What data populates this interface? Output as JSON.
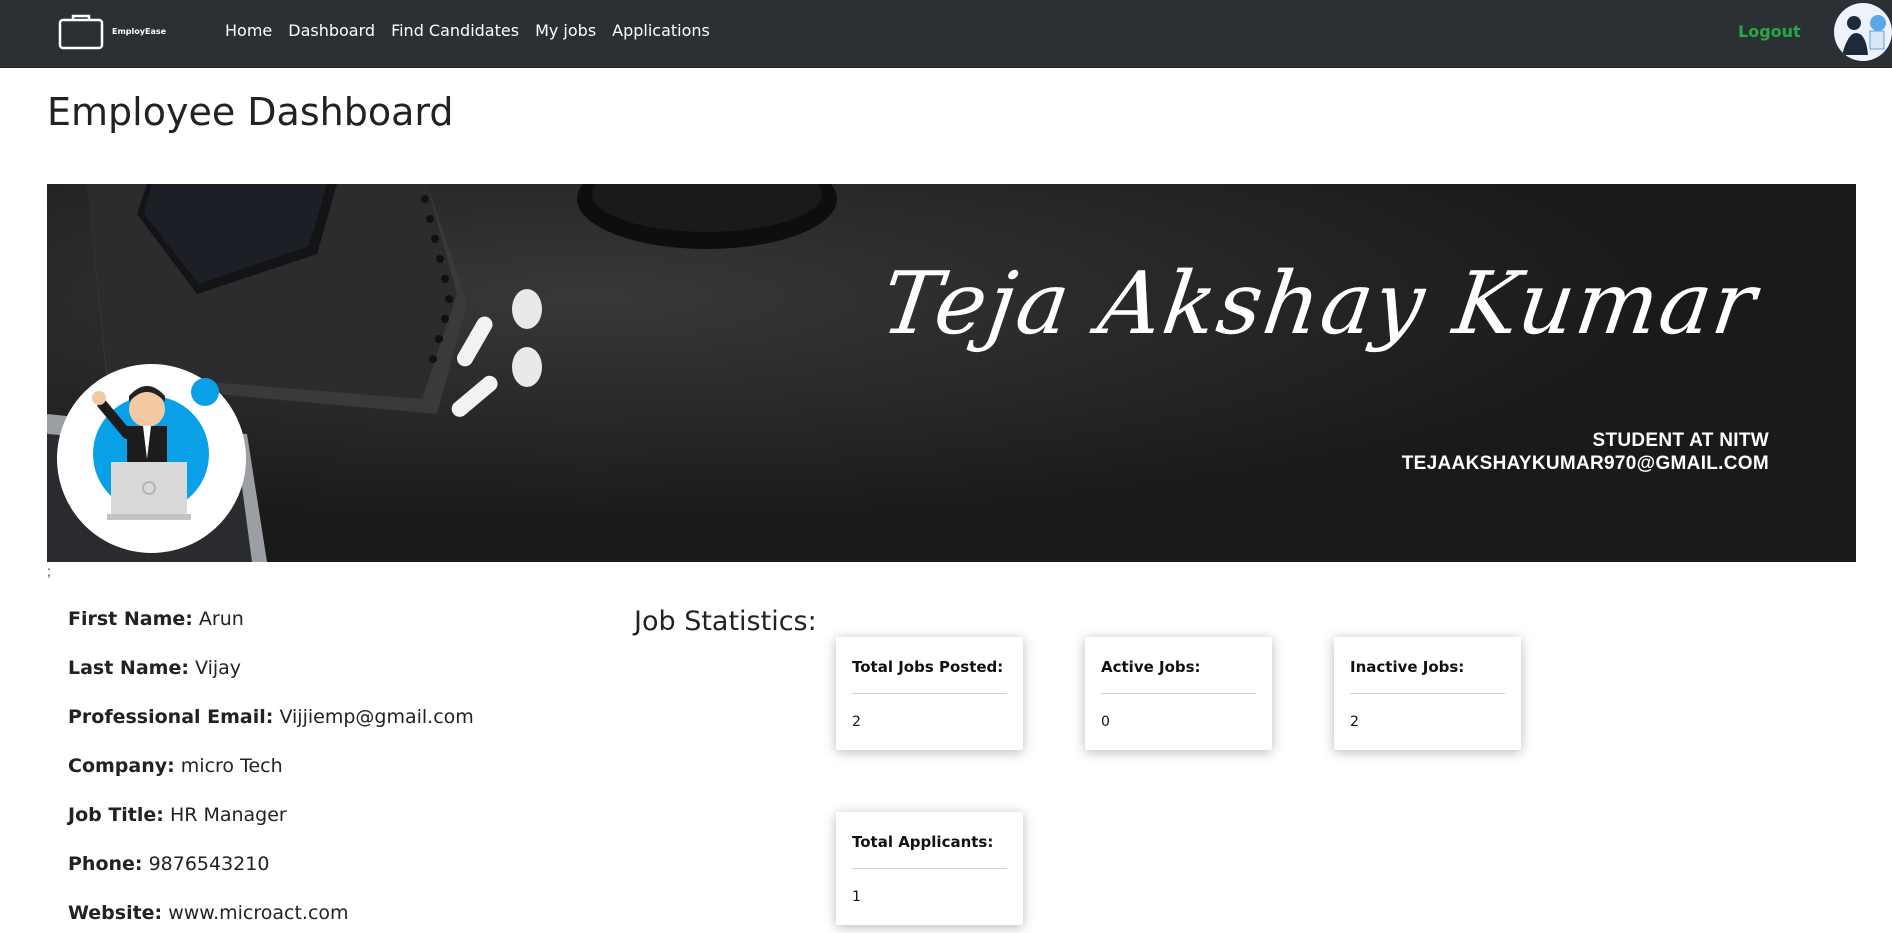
{
  "nav": {
    "brand": "EmployEase",
    "links": [
      "Home",
      "Dashboard",
      "Find Candidates",
      "My jobs",
      "Applications"
    ],
    "logout": "Logout"
  },
  "page_title": "Employee Dashboard",
  "banner": {
    "name": "Teja Akshay Kumar",
    "line1": "STUDENT AT NITW",
    "line2": "TEJAAKSHAYKUMAR970@GMAIL.COM"
  },
  "stray_text": ";",
  "profile": {
    "first_name": {
      "label": "First Name:",
      "value": "Arun"
    },
    "last_name": {
      "label": "Last Name:",
      "value": "Vijay"
    },
    "email": {
      "label": "Professional Email:",
      "value": "Vijjiemp@gmail.com"
    },
    "company": {
      "label": "Company:",
      "value": "micro Tech"
    },
    "job_title": {
      "label": "Job Title:",
      "value": "HR Manager"
    },
    "phone": {
      "label": "Phone:",
      "value": "9876543210"
    },
    "website": {
      "label": "Website:",
      "value": "www.microact.com"
    }
  },
  "stats": {
    "title": "Job Statistics:",
    "cards": [
      {
        "label": "Total Jobs Posted:",
        "value": "2"
      },
      {
        "label": "Active Jobs:",
        "value": "0"
      },
      {
        "label": "Inactive Jobs:",
        "value": "2"
      },
      {
        "label": "Total Applicants:",
        "value": "1"
      }
    ]
  },
  "colors": {
    "navbar": "#2b3035",
    "logout": "#28a745",
    "banner": "#1f1f20",
    "avatar_accent": "#0aa0e8"
  }
}
